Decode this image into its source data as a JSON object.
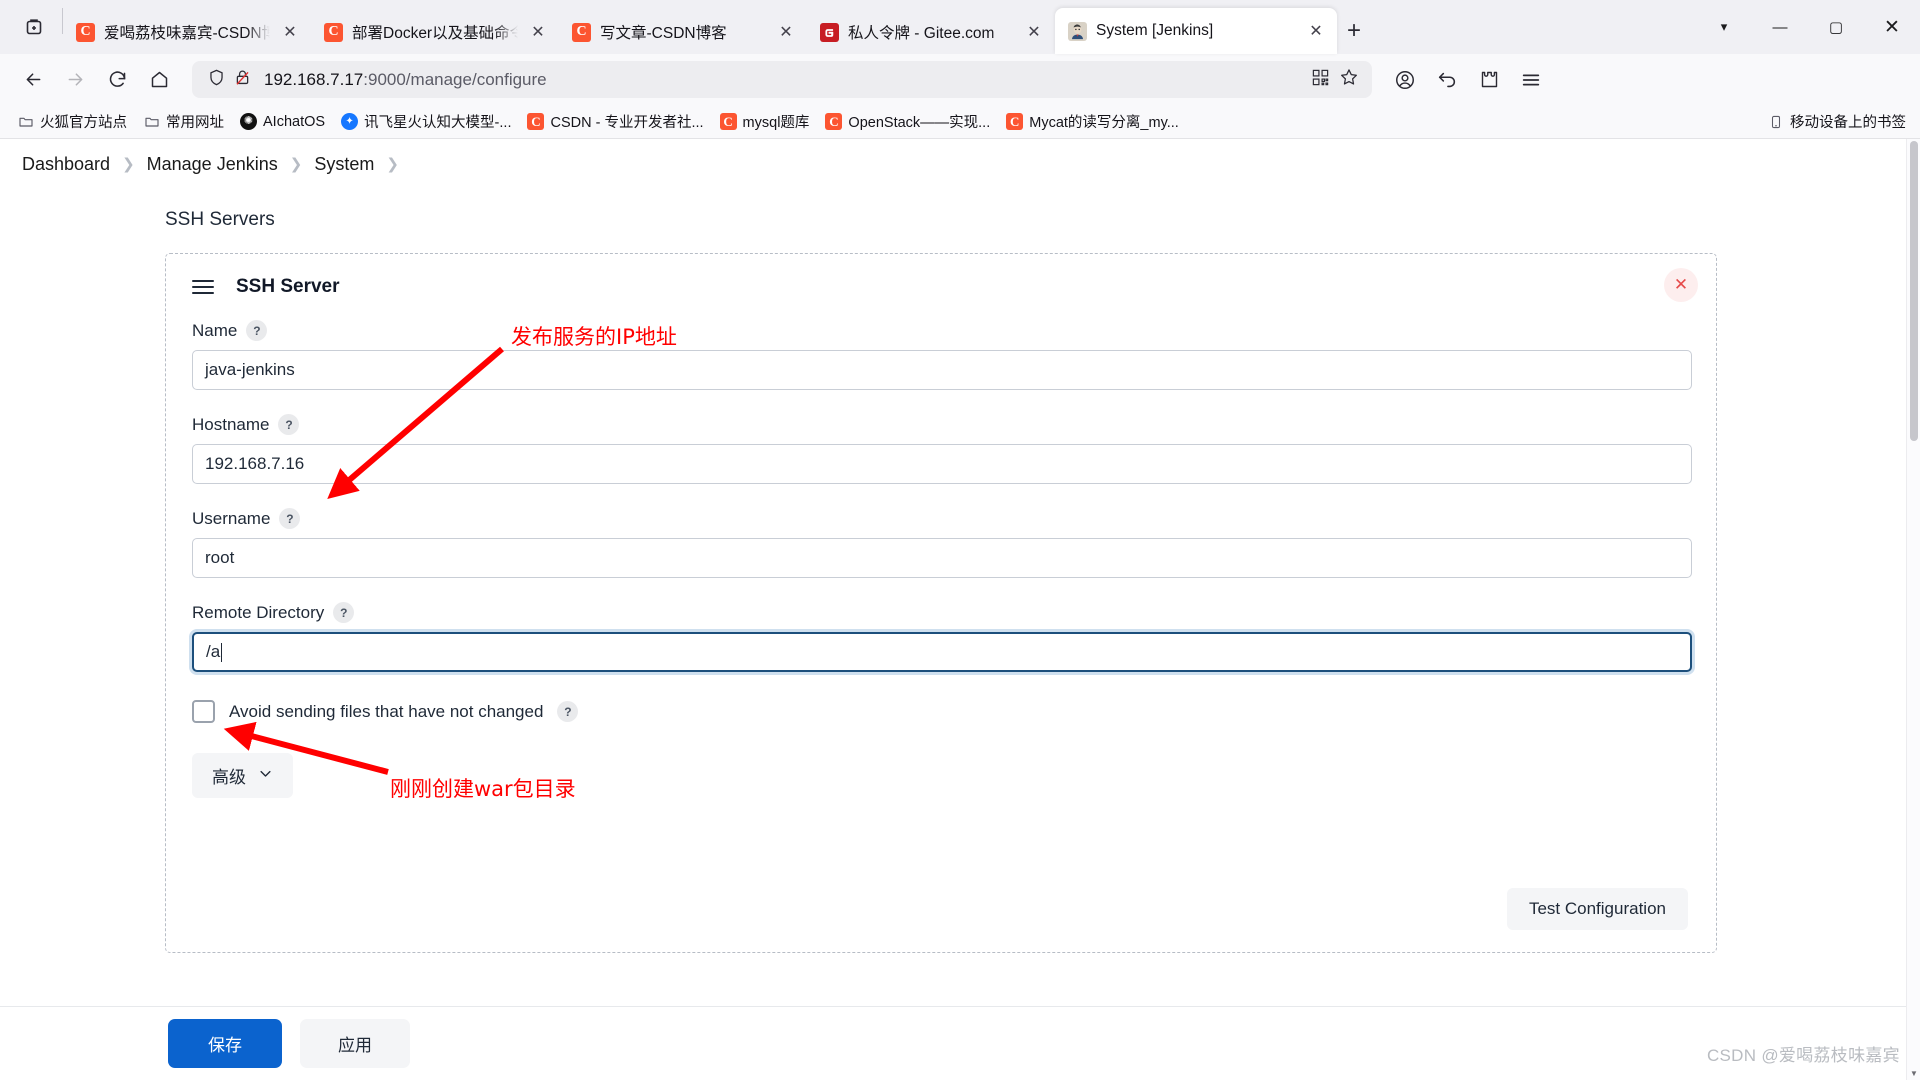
{
  "browser": {
    "tabs": [
      {
        "title": "爱喝荔枝味嘉宾-CSDN博客",
        "favicon": "csdn-icon",
        "active": false,
        "close_label": "✕"
      },
      {
        "title": "部署Docker以及基础命令-CSDN博客",
        "favicon": "csdn-icon",
        "active": false,
        "close_label": "✕"
      },
      {
        "title": "写文章-CSDN博客",
        "favicon": "csdn-icon",
        "active": false,
        "close_label": "✕"
      },
      {
        "title": "私人令牌 - Gitee.com",
        "favicon": "gitee-icon",
        "active": false,
        "close_label": "✕"
      },
      {
        "title": "System [Jenkins]",
        "favicon": "jenkins-icon",
        "active": true,
        "close_label": "✕"
      }
    ],
    "new_tab_label": "+",
    "list_all_tabs_label": "▾",
    "window_controls": {
      "minimize": "—",
      "maximize": "▢",
      "close": "✕"
    },
    "url": {
      "host": "192.168.7.17",
      "path": ":9000/manage/configure"
    },
    "bookmarks": [
      {
        "label": "火狐官方站点",
        "icon": "folder-icon"
      },
      {
        "label": "常用网址",
        "icon": "folder-icon"
      },
      {
        "label": "AIchatOS",
        "icon": "alchatos-icon"
      },
      {
        "label": "讯飞星火认知大模型-...",
        "icon": "xunfei-icon"
      },
      {
        "label": "CSDN - 专业开发者社...",
        "icon": "csdn-icon"
      },
      {
        "label": "mysql题库",
        "icon": "csdn-icon"
      },
      {
        "label": "OpenStack——实现...",
        "icon": "csdn-icon"
      },
      {
        "label": "Mycat的读写分离_my...",
        "icon": "csdn-icon"
      }
    ],
    "bookmarks_right": {
      "label": "移动设备上的书签",
      "icon": "mobile-icon"
    }
  },
  "jenkins": {
    "breadcrumb": [
      {
        "label": "Dashboard"
      },
      {
        "label": "Manage Jenkins"
      },
      {
        "label": "System"
      }
    ],
    "breadcrumb_separator": "❯",
    "section_title": "SSH Servers",
    "block": {
      "title": "SSH Server",
      "delete_label": "✕",
      "help_badge": "?",
      "fields": [
        {
          "label": "Name",
          "value": "java-jenkins",
          "focused": false
        },
        {
          "label": "Hostname",
          "value": "192.168.7.16",
          "focused": false
        },
        {
          "label": "Username",
          "value": "root",
          "focused": false
        },
        {
          "label": "Remote Directory",
          "value": "/a",
          "focused": true
        }
      ],
      "checkbox_label": "Avoid sending files that have not changed",
      "advanced_label": "高级",
      "advanced_chevron": "⌄",
      "test_config_label": "Test Configuration"
    },
    "footer": {
      "save_label": "保存",
      "apply_label": "应用"
    }
  },
  "annotations": [
    {
      "text": "发布服务的IP地址",
      "color": "#ff0000"
    },
    {
      "text": "刚刚创建war包目录",
      "color": "#ff0000"
    }
  ],
  "watermark": "CSDN @爱喝荔枝味嘉宾"
}
